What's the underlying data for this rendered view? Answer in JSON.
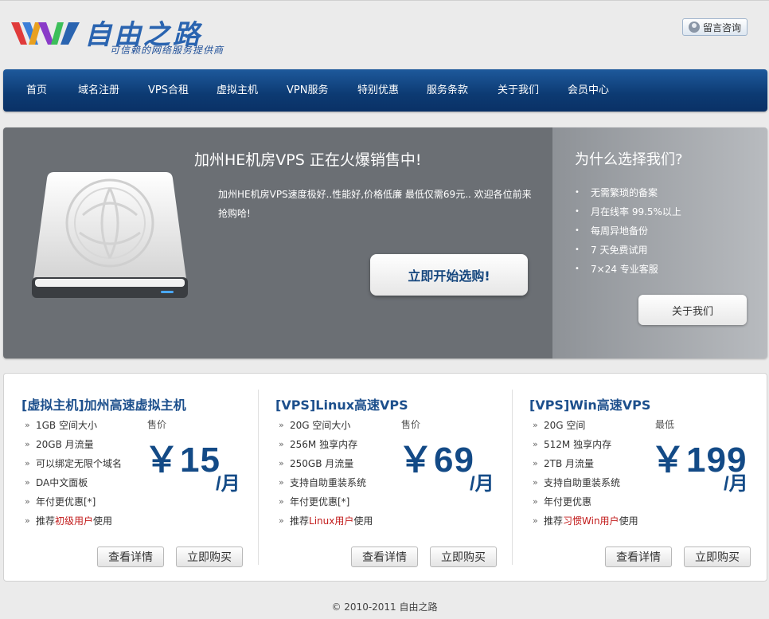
{
  "header": {
    "logo_title": "自由之路",
    "logo_subtitle": "可信赖的网络服务提供商",
    "consult_label": "留言咨询"
  },
  "nav": {
    "items": [
      "首页",
      "域名注册",
      "VPS合租",
      "虚拟主机",
      "VPN服务",
      "特别优惠",
      "服务条款",
      "关于我们",
      "会员中心"
    ]
  },
  "hero": {
    "title": "加州HE机房VPS 正在火爆销售中!",
    "description": "加州HE机房VPS速度极好..性能好,价格低廉 最低仅需69元.. 欢迎各位前来抢购哈!",
    "start_label": "立即开始选购!"
  },
  "why": {
    "title": "为什么选择我们?",
    "items": [
      "无需繁琐的备案",
      "月在线率 99.5%以上",
      "每周异地备份",
      "7 天免费试用",
      "7×24 专业客服"
    ],
    "about_label": "关于我们"
  },
  "products": [
    {
      "title": "[虚拟主机]加州高速虚拟主机",
      "features": [
        "1GB 空间大小",
        "20GB 月流量",
        "可以绑定无限个域名",
        "DA中文面板",
        "年付更优惠[*]"
      ],
      "last_feature": {
        "prefix": "推荐",
        "highlight": "初级用户",
        "suffix": "使用"
      },
      "price_label": "售价",
      "price": "￥15",
      "per": "/月",
      "detail_label": "查看详情",
      "buy_label": "立即购买"
    },
    {
      "title": "[VPS]Linux高速VPS",
      "features": [
        "20G 空间大小",
        "256M 独享内存",
        "250GB 月流量",
        "支持自助重装系统",
        "年付更优惠[*]"
      ],
      "last_feature": {
        "prefix": "推荐",
        "highlight": "Linux用户",
        "suffix": "使用"
      },
      "price_label": "售价",
      "price": "￥69",
      "per": "/月",
      "detail_label": "查看详情",
      "buy_label": "立即购买"
    },
    {
      "title": "[VPS]Win高速VPS",
      "features": [
        "20G 空间",
        "512M 独享内存",
        "2TB 月流量",
        "支持自助重装系统",
        "年付更优惠"
      ],
      "last_feature": {
        "prefix": "推荐",
        "highlight": "习惯Win用户",
        "suffix": "使用"
      },
      "price_label": "最低",
      "price": "￥199",
      "per": "/月",
      "detail_label": "查看详情",
      "buy_label": "立即购买"
    }
  ],
  "footer": {
    "copyright": "© 2010-2011 自由之路"
  },
  "colors": {
    "nav_bg": "#0c3a72",
    "price": "#134a86",
    "highlight_red": "#c21b1b",
    "hero_left_bg": "#6b6f74"
  }
}
